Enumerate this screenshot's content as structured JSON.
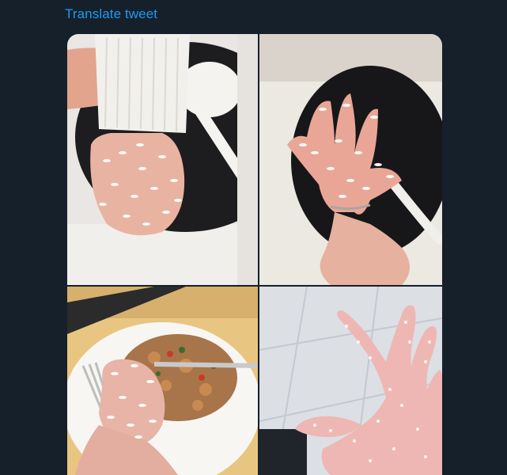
{
  "tweet": {
    "translate_label": "Translate tweet"
  },
  "colors": {
    "background": "#15202b",
    "link": "#1d9bf0"
  },
  "media": {
    "photo_count": 4
  }
}
